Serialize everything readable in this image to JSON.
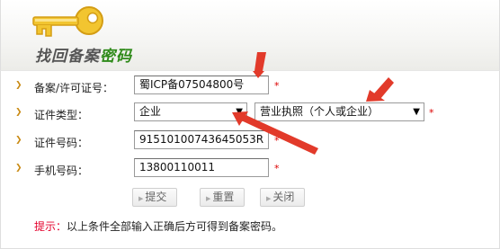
{
  "header": {
    "title": "找回备案",
    "title_accent": "密码"
  },
  "form": {
    "license": {
      "label": "备案/许可证号：",
      "value": "蜀ICP备07504800号",
      "required": "*"
    },
    "cert_type": {
      "label": "证件类型：",
      "type_value": "企业",
      "subtype_value": "营业执照（个人或企业）",
      "required": "*"
    },
    "cert_number": {
      "label": "证件号码：",
      "value": "91510100743645053R",
      "required": "*"
    },
    "phone": {
      "label": "手机号码：",
      "value": "13800110011",
      "required": "*"
    }
  },
  "buttons": {
    "submit": "提交",
    "reset": "重置",
    "close": "关闭"
  },
  "tip": {
    "label": "提示：",
    "text": "以上条件全部输入正确后方可得到备案密码。"
  },
  "icons": {
    "key": "key-icon",
    "bullet": "bullet-arrow-icon",
    "button_marker": "triangle-right-icon",
    "dropdown": "caret-down-icon"
  },
  "colors": {
    "accent_green": "#2e8a19",
    "required_red": "#dd0000",
    "tip_red": "#e4002b",
    "annotation_red": "#e23a2a",
    "key_gold": "#f2c530"
  }
}
